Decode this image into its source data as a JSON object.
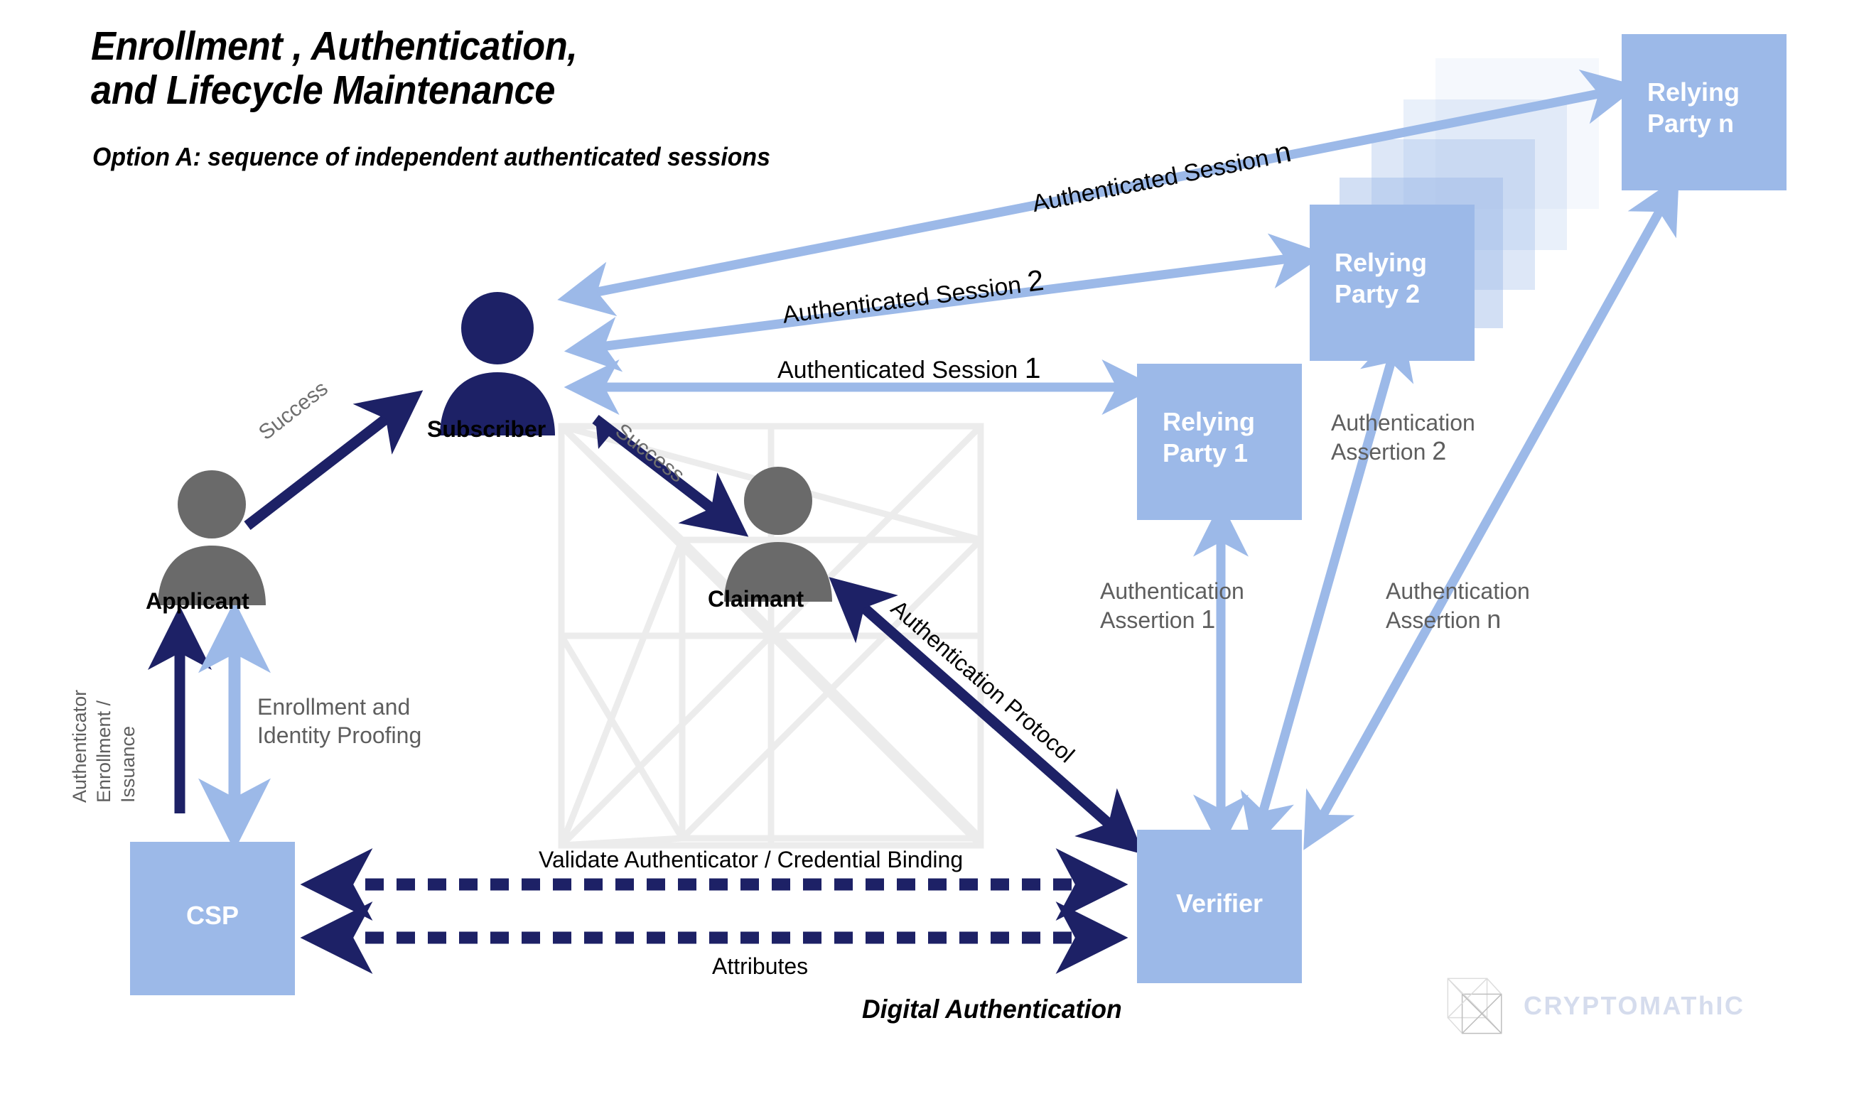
{
  "header": {
    "title": "Enrollment ,  Authentication,\nand Lifecycle Maintenance",
    "subtitle": "Option A: sequence of independent authenticated sessions"
  },
  "caption": "Digital Authentication",
  "colors": {
    "navy": "#1d2166",
    "light_blue": "#9cb9e8",
    "box_blue": "#9cb9e8",
    "gray_person": "#6a6a6a",
    "gray_text": "#5e5e5e",
    "watermark": "#ededed",
    "logo_text": "#d5dced"
  },
  "actors": {
    "applicant": {
      "label": "Applicant",
      "icon": "person-icon",
      "color": "#6a6a6a"
    },
    "subscriber": {
      "label": "Subscriber",
      "icon": "person-icon",
      "color": "#1d2166"
    },
    "claimant": {
      "label": "Claimant",
      "icon": "person-icon",
      "color": "#6a6a6a"
    }
  },
  "boxes": {
    "csp": "CSP",
    "verifier": "Verifier",
    "relying_party_1": "Relying\nParty 1",
    "relying_party_2": "Relying\nParty 2",
    "relying_party_n": "Relying\nParty n"
  },
  "flows": {
    "success_1": "Success",
    "success_2": "Success",
    "authenticator_enrollment": "Authenticator\nEnrollment /\nIssuance",
    "enrollment_identity_proofing": "Enrollment and\nIdentity Proofing",
    "validate_binding": "Validate Authenticator / Credential Binding",
    "attributes": "Attributes",
    "authentication_protocol": "Authentication Protocol",
    "session_1_text": "Authenticated Session ",
    "session_1_num": "1",
    "session_2_text": "Authenticated Session ",
    "session_2_num": "2",
    "session_n_text": "Authenticated Session ",
    "session_n_num": "n",
    "assertion_1": "Authentication\nAssertion ",
    "assertion_1_num": "1",
    "assertion_2": "Authentication\nAssertion ",
    "assertion_2_num": "2",
    "assertion_n": "Authentication\nAssertion ",
    "assertion_n_num": "n"
  },
  "branding": {
    "name": "CRYPTOMAThIC",
    "icon": "tesseract-cube-icon"
  }
}
